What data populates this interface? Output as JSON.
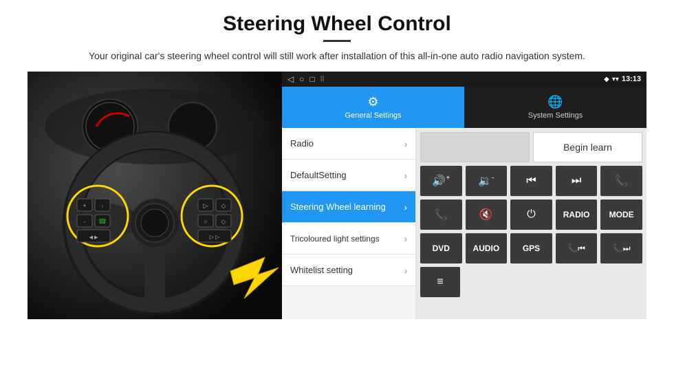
{
  "page": {
    "title": "Steering Wheel Control",
    "subtitle": "Your original car's steering wheel control will still work after installation of this all-in-one auto radio navigation system."
  },
  "status_bar": {
    "nav_back": "◁",
    "nav_home": "○",
    "nav_square": "□",
    "nav_dots": "⁞",
    "location_icon": "♦",
    "wifi_icon": "▾",
    "time": "13:13"
  },
  "tabs": [
    {
      "id": "general",
      "label": "General Settings",
      "active": true
    },
    {
      "id": "system",
      "label": "System Settings",
      "active": false
    }
  ],
  "menu_items": [
    {
      "id": "radio",
      "label": "Radio",
      "active": false
    },
    {
      "id": "default",
      "label": "DefaultSetting",
      "active": false
    },
    {
      "id": "steering",
      "label": "Steering Wheel learning",
      "active": true
    },
    {
      "id": "tricoloured",
      "label": "Tricoloured light settings",
      "active": false
    },
    {
      "id": "whitelist",
      "label": "Whitelist setting",
      "active": false
    }
  ],
  "controls": {
    "begin_learn_label": "Begin learn",
    "row1": [
      {
        "id": "vol_up",
        "symbol": "🔊+"
      },
      {
        "id": "vol_down",
        "symbol": "🔉-"
      },
      {
        "id": "prev_track",
        "symbol": "⏮"
      },
      {
        "id": "next_track",
        "symbol": "⏭"
      },
      {
        "id": "phone",
        "symbol": "📞"
      }
    ],
    "row2": [
      {
        "id": "call_accept",
        "symbol": "📞"
      },
      {
        "id": "mute",
        "symbol": "🔇"
      },
      {
        "id": "power",
        "symbol": "⏻"
      },
      {
        "id": "radio_btn",
        "symbol": "RADIO",
        "text": true
      },
      {
        "id": "mode_btn",
        "symbol": "MODE",
        "text": true
      }
    ],
    "row3": [
      {
        "id": "dvd",
        "symbol": "DVD",
        "text": true
      },
      {
        "id": "audio",
        "symbol": "AUDIO",
        "text": true
      },
      {
        "id": "gps",
        "symbol": "GPS",
        "text": true
      },
      {
        "id": "phone2",
        "symbol": "📞⏮"
      },
      {
        "id": "skip",
        "symbol": "⏭📞"
      }
    ],
    "row4": [
      {
        "id": "list_icon",
        "symbol": "≡"
      }
    ]
  }
}
